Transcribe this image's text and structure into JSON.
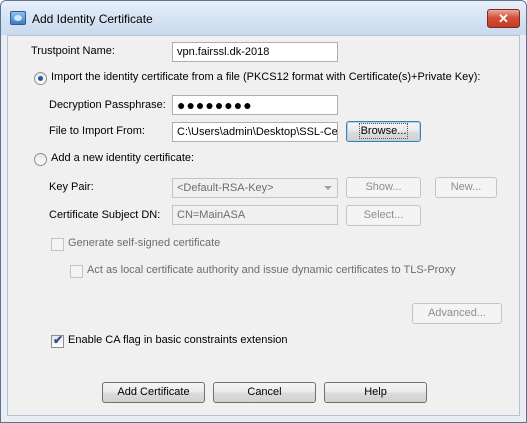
{
  "window": {
    "title": "Add Identity Certificate",
    "close_glyph": "✕",
    "icon": "certificate-app-icon"
  },
  "form": {
    "trustpoint_label": "Trustpoint Name:",
    "trustpoint_value": "vpn.fairssl.dk-2018",
    "import_radio_label": "Import the identity certificate from a file (PKCS12 format with Certificate(s)+Private Key):",
    "import_selected": true,
    "passphrase_label": "Decryption Passphrase:",
    "passphrase_value": "●●●●●●●●",
    "file_label": "File to Import From:",
    "file_value": "C:\\Users\\admin\\Desktop\\SSL-Certificate",
    "browse_label": "Browse...",
    "new_radio_label": "Add a new identity certificate:",
    "new_selected": false,
    "keypair_label": "Key Pair:",
    "keypair_value": "<Default-RSA-Key>",
    "show_label": "Show...",
    "new_label": "New...",
    "subject_label": "Certificate Subject DN:",
    "subject_value": "CN=MainASA",
    "select_label": "Select...",
    "selfsigned_label": "Generate self-signed certificate",
    "selfsigned_checked": false,
    "localca_label": "Act as local certificate authority and issue dynamic certificates to TLS-Proxy",
    "localca_checked": false,
    "advanced_label": "Advanced...",
    "caflag_label": "Enable CA flag in basic constraints extension",
    "caflag_checked": true,
    "check_glyph": "✔"
  },
  "footer": {
    "add_label": "Add Certificate",
    "cancel_label": "Cancel",
    "help_label": "Help"
  },
  "colors": {
    "accent": "#1e5aa5",
    "close_button": "#c43b23",
    "dialog_bg": "#f0f0f0"
  }
}
